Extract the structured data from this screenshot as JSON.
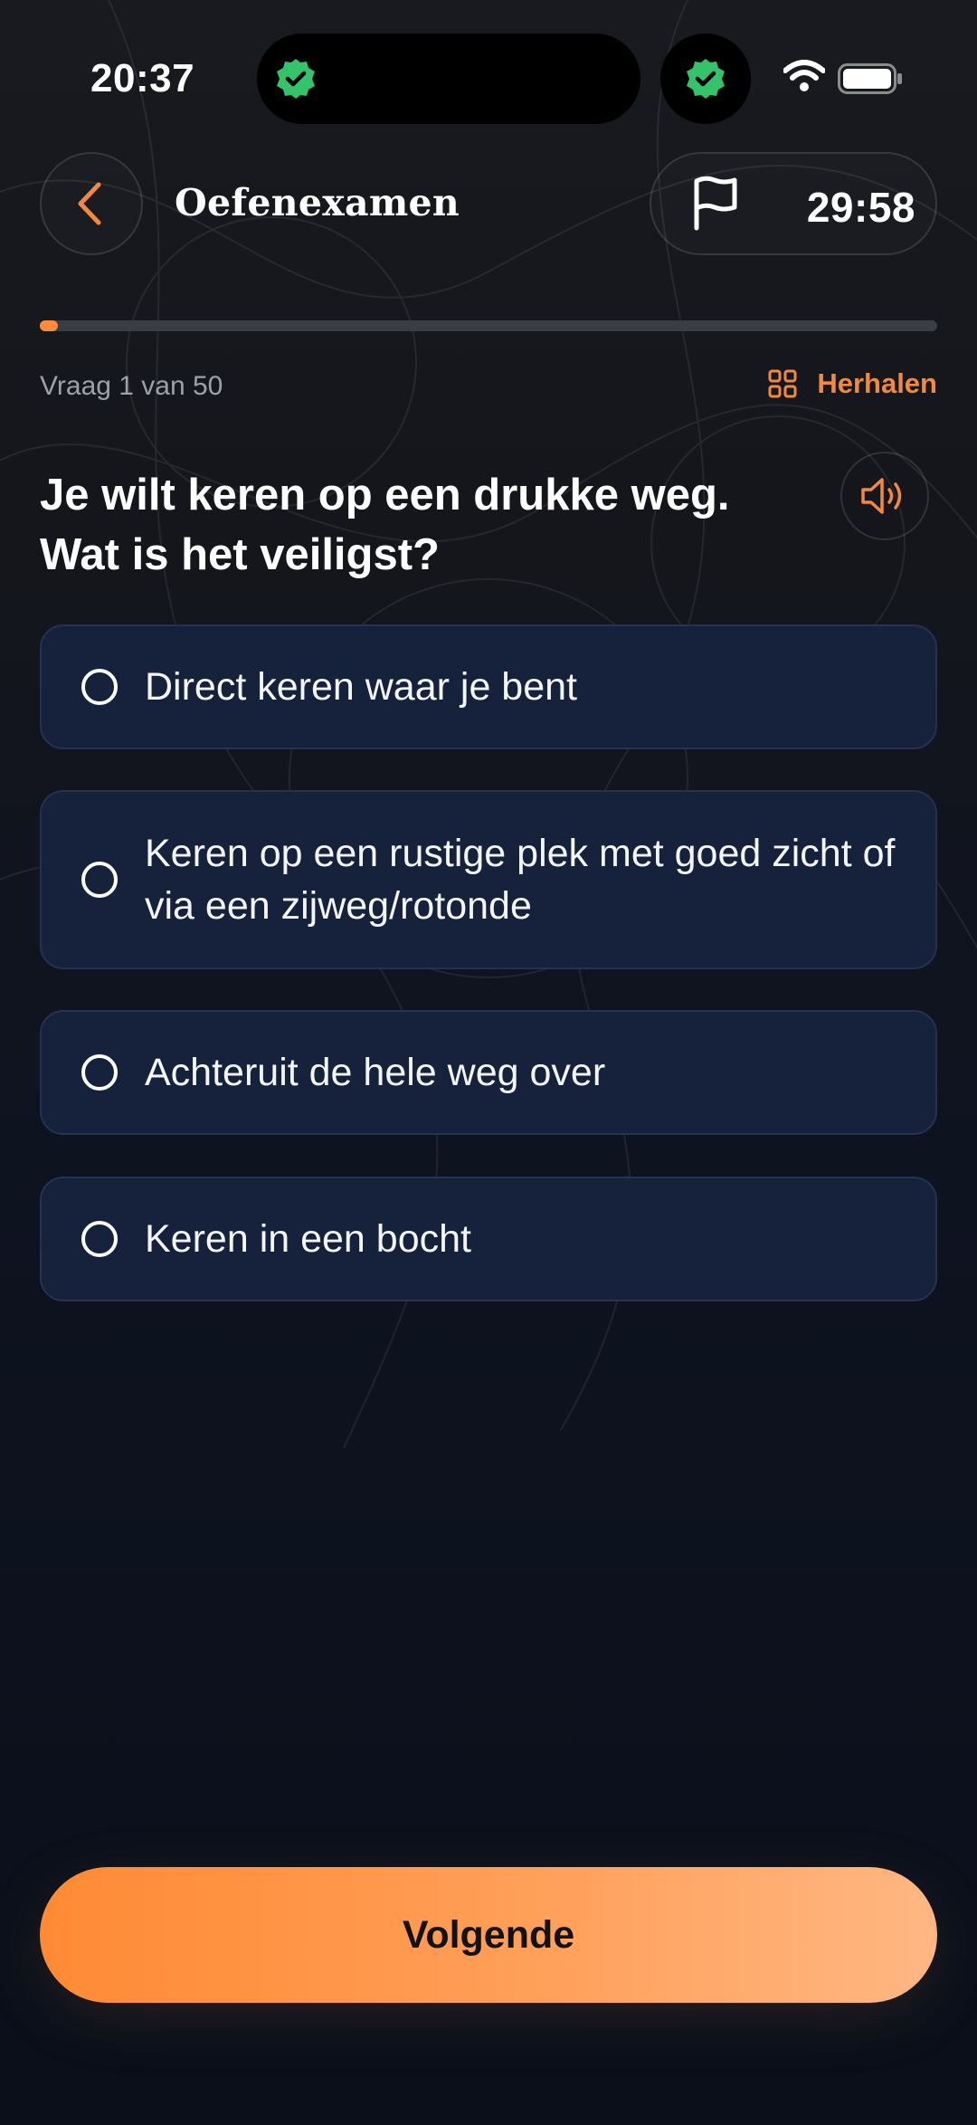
{
  "status_bar": {
    "time": "20:37",
    "icons": [
      "verified-shield-icon",
      "verified-shield-icon",
      "wifi-icon",
      "battery-icon"
    ]
  },
  "header": {
    "title": "Oefenexamen",
    "back_icon": "chevron-left-icon",
    "flag_icon": "flag-icon",
    "timer": "29:58"
  },
  "progress": {
    "fraction": 0.02,
    "counter_text": "Vraag 1 van 50",
    "repeat_label": "Herhalen",
    "repeat_icon": "grid-icon"
  },
  "question": {
    "text": "Je wilt keren op een drukke weg. Wat is het veiligst?",
    "audio_icon": "speaker-icon"
  },
  "options": [
    {
      "label": "Direct keren waar je bent",
      "selected": false
    },
    {
      "label": "Keren op een rustige plek met goed zicht of via een zijweg/rotonde",
      "selected": false
    },
    {
      "label": "Achteruit de hele weg over",
      "selected": false
    },
    {
      "label": "Keren in een bocht",
      "selected": false
    }
  ],
  "next_button": {
    "label": "Volgende"
  },
  "colors": {
    "accent": "#ff8a3a",
    "option_bg": "#16213b",
    "badge_green": "#34c26b"
  }
}
